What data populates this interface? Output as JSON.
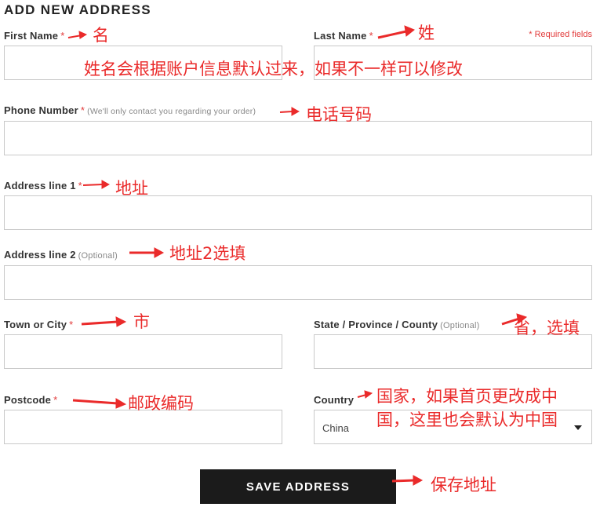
{
  "form": {
    "title": "ADD NEW ADDRESS",
    "required_note": "* Required fields",
    "required_marker": "*",
    "fields": {
      "first_name": {
        "label": "First Name",
        "value": ""
      },
      "last_name": {
        "label": "Last Name",
        "value": ""
      },
      "phone": {
        "label": "Phone Number",
        "hint": "(We'll only contact you regarding your order)",
        "value": ""
      },
      "address1": {
        "label": "Address line 1",
        "value": ""
      },
      "address2": {
        "label": "Address line 2",
        "optional": "(Optional)",
        "value": ""
      },
      "city": {
        "label": "Town or City",
        "value": ""
      },
      "state": {
        "label": "State / Province / County",
        "optional": "(Optional)",
        "value": ""
      },
      "postcode": {
        "label": "Postcode",
        "value": ""
      },
      "country": {
        "label": "Country",
        "value": "China"
      }
    },
    "submit_label": "SAVE ADDRESS"
  },
  "annotations": {
    "first_name": "名",
    "last_name": "姓",
    "name_default": "姓名会根据账户信息默认过来，如果不一样可以修改",
    "phone": "电话号码",
    "address1": "地址",
    "address2": "地址2选填",
    "city": "市",
    "state": "省，选填",
    "postcode": "邮政编码",
    "country_line1": "国家，如果首页更改成中",
    "country_line2": "国，这里也会默认为中国",
    "save": "保存地址"
  },
  "colors": {
    "annotation": "#ea2a2a",
    "required": "#e23b3b",
    "button_bg": "#1b1b1b"
  }
}
